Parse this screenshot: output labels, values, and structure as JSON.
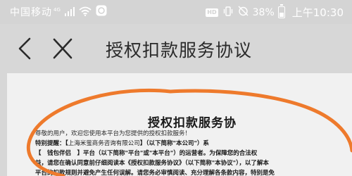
{
  "status_bar": {
    "carrier": "中国移动",
    "network": "4G",
    "hd": "HD",
    "battery": "38%",
    "time": "上午10:30"
  },
  "header": {
    "title": "授权扣款服务协议"
  },
  "document": {
    "heading": "授权扣款服务协",
    "greeting": "尊敬的用户，欢迎您使用本平台为您提供的授权扣款服务！",
    "notice_prefix": "特别提醒：【",
    "company": "上海米萤商务咨询有限公司",
    "notice_suffix": "】（以下简称\"本公司\"）系",
    "line3_part1": "【　钱包伴侣　】平台（以下简称\"平台\"或\"本平台\"）的运营者。为保障您的合法权",
    "line4": "益，请您在确认同意前仔细阅读本《授权扣款服务协议》（以下简称\"本协议\"），以了解本",
    "line5": "平台的扣款规则并避免产生任何误解。请您务必审慎阅读、充分理解各条款内容，特别是免"
  },
  "colors": {
    "status_bar_bg": "#d4d4d4",
    "header_bg": "#d7d7d7",
    "annotation_stroke": "#ee7a2c"
  }
}
